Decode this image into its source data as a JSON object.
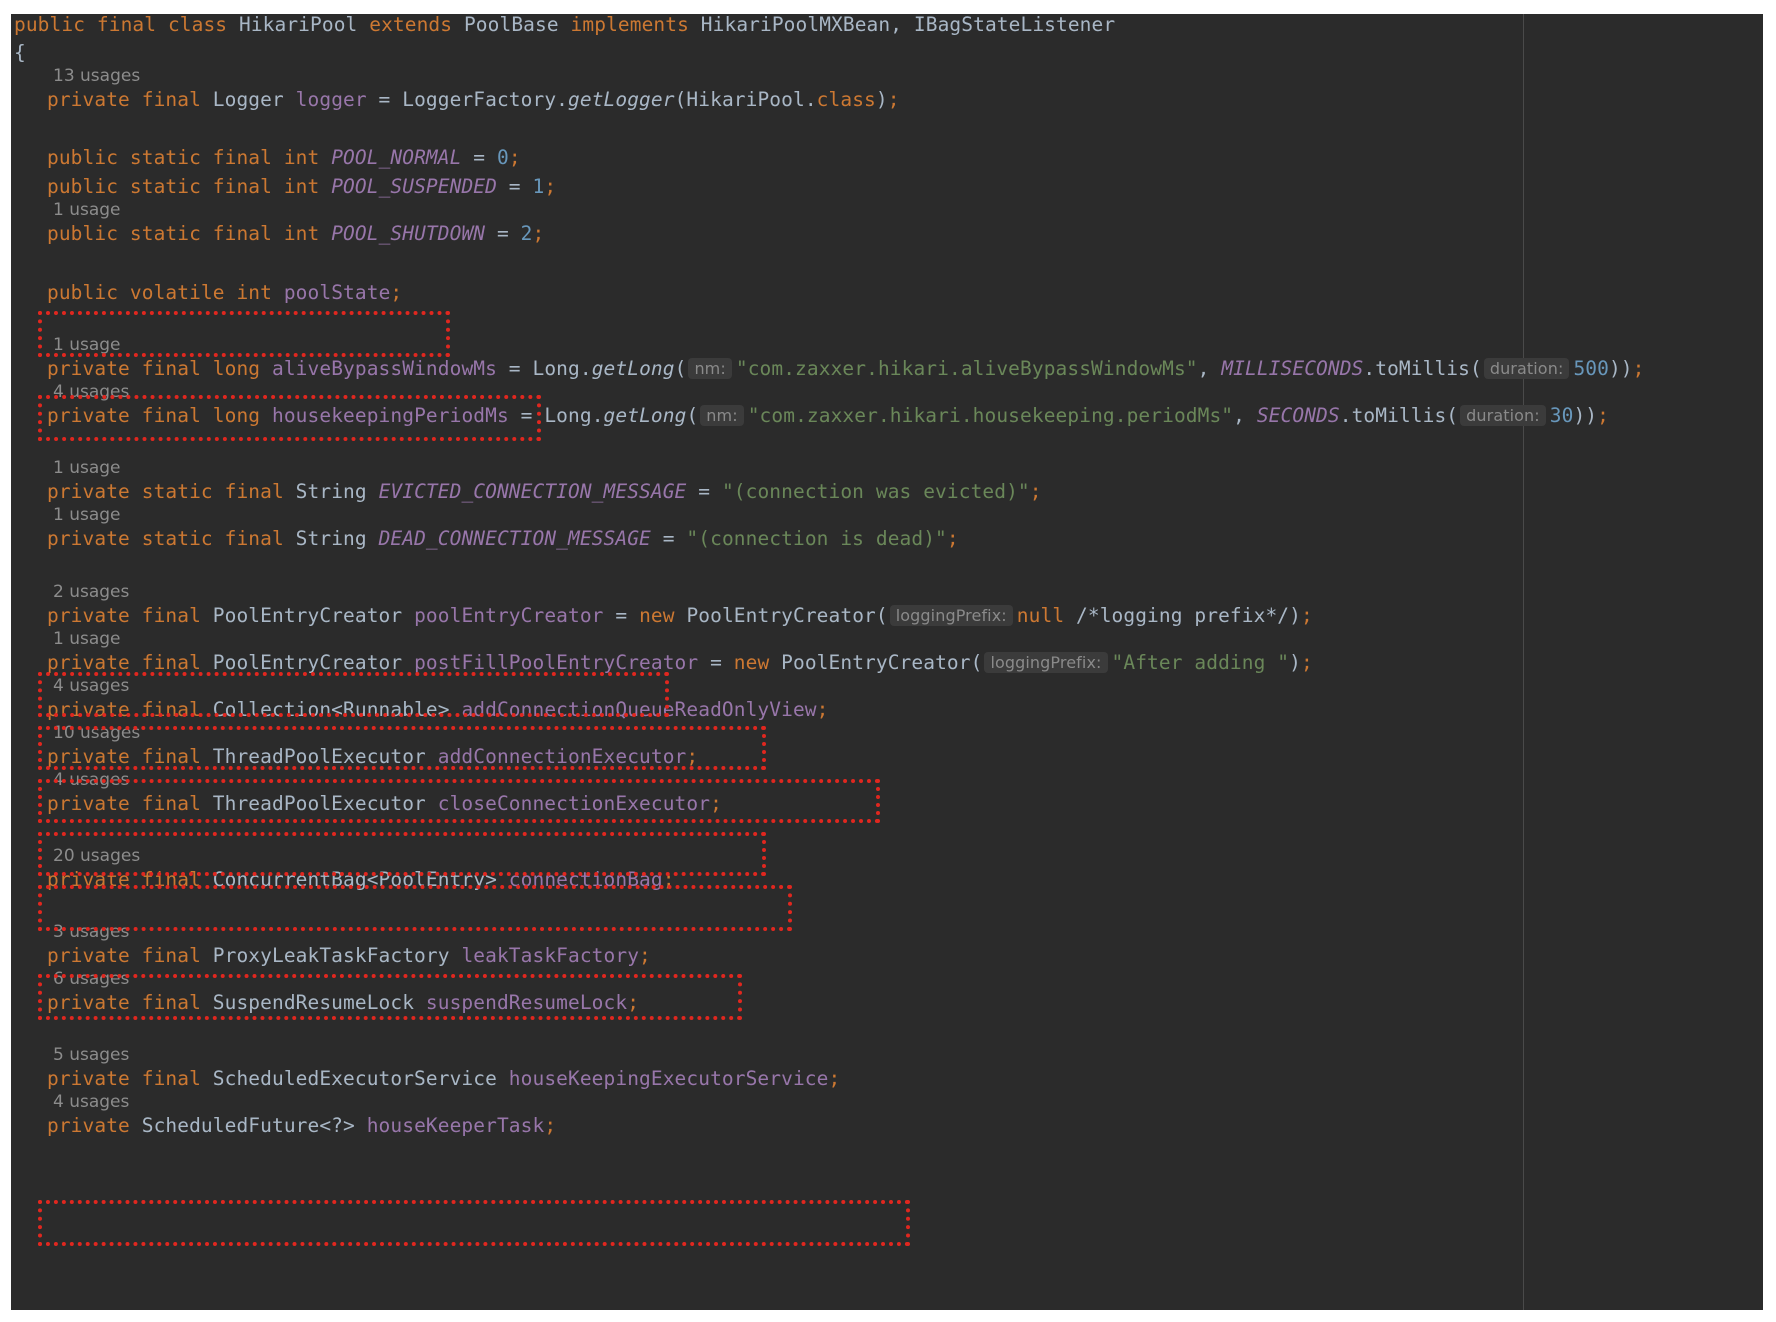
{
  "class_decl": {
    "kw1": "public",
    "kw2": "final",
    "kw3": "class",
    "name": "HikariPool",
    "kw_extends": "extends",
    "base": "PoolBase",
    "kw_implements": "implements",
    "ifaces": "HikariPoolMXBean, IBagStateListener"
  },
  "open_brace": "{",
  "usages": {
    "logger": "13 usages",
    "pool_shutdown": "1 usage",
    "alive_bypass": "1 usage",
    "housekeeping": "4 usages",
    "evicted": "1 usage",
    "dead": "1 usage",
    "pool_entry_creator": "2 usages",
    "post_fill": "1 usage",
    "add_queue": "4 usages",
    "add_exec": "10 usages",
    "close_exec": "4 usages",
    "bag": "20 usages",
    "leak": "3 usages",
    "suspend": "6 usages",
    "housekeeping_exec": "5 usages",
    "housekeeper_task": "4 usages"
  },
  "tokens": {
    "private": "private",
    "public": "public",
    "static": "static",
    "final": "final",
    "int": "int",
    "long": "long",
    "volatile": "volatile",
    "new": "new",
    "null": "null",
    "class_kw": "class",
    "eq": " = ",
    "semi": ";"
  },
  "fields": {
    "logger": {
      "type": "Logger",
      "name": "logger",
      "factory": "LoggerFactory.",
      "method": "getLogger",
      "arg": "(HikariPool."
    },
    "pool_normal": {
      "name": "POOL_NORMAL",
      "value": "0"
    },
    "pool_suspended": {
      "name": "POOL_SUSPENDED",
      "value": "1"
    },
    "pool_shutdown": {
      "name": "POOL_SHUTDOWN",
      "value": "2"
    },
    "pool_state": {
      "name": "poolState"
    },
    "alive_bypass": {
      "name": "aliveBypassWindowMs",
      "call": "Long.",
      "method": "getLong",
      "hint_nm": "nm:",
      "key": "\"com.zaxxer.hikari.aliveBypassWindowMs\"",
      "unit": "MILLISECONDS",
      "to": ".toMillis(",
      "hint_dur": "duration:",
      "value": "500"
    },
    "housekeeping": {
      "name": "housekeepingPeriodMs",
      "call": "Long.",
      "method": "getLong",
      "hint_nm": "nm:",
      "key": "\"com.zaxxer.hikari.housekeeping.periodMs\"",
      "unit": "SECONDS",
      "to": ".toMillis(",
      "hint_dur": "duration:",
      "value": "30"
    },
    "evicted": {
      "type": "String",
      "name": "EVICTED_CONNECTION_MESSAGE",
      "value": "\"(connection was evicted)\""
    },
    "dead": {
      "type": "String",
      "name": "DEAD_CONNECTION_MESSAGE",
      "value": "\"(connection is dead)\""
    },
    "pool_entry_creator": {
      "type": "PoolEntryCreator",
      "name": "poolEntryCreator",
      "ctor": "PoolEntryCreator(",
      "hint": "loggingPrefix:",
      "comment": "/*logging prefix*/"
    },
    "post_fill": {
      "type": "PoolEntryCreator",
      "name": "postFillPoolEntryCreator",
      "ctor": "PoolEntryCreator(",
      "hint": "loggingPrefix:",
      "value": "\"After adding \""
    },
    "add_queue": {
      "type": "Collection<Runnable>",
      "name": "addConnectionQueueReadOnlyView"
    },
    "add_exec": {
      "type": "ThreadPoolExecutor",
      "name": "addConnectionExecutor"
    },
    "close_exec": {
      "type": "ThreadPoolExecutor",
      "name": "closeConnectionExecutor"
    },
    "bag": {
      "type": "ConcurrentBag<PoolEntry>",
      "name": "connectionBag"
    },
    "leak": {
      "type": "ProxyLeakTaskFactory",
      "name": "leakTaskFactory"
    },
    "suspend": {
      "type": "SuspendResumeLock",
      "name": "suspendResumeLock"
    },
    "housekeeping_exec": {
      "type": "ScheduledExecutorService",
      "name": "houseKeepingExecutorService"
    },
    "housekeeper_task": {
      "type": "ScheduledFuture<?>",
      "name": "houseKeeperTask"
    }
  },
  "colors": {
    "background": "#2b2b2b",
    "keyword": "#cc7832",
    "field": "#9876aa",
    "string": "#6a8759",
    "number": "#6897bb",
    "text": "#a9b7c6",
    "highlight_box": "#e0271f"
  }
}
